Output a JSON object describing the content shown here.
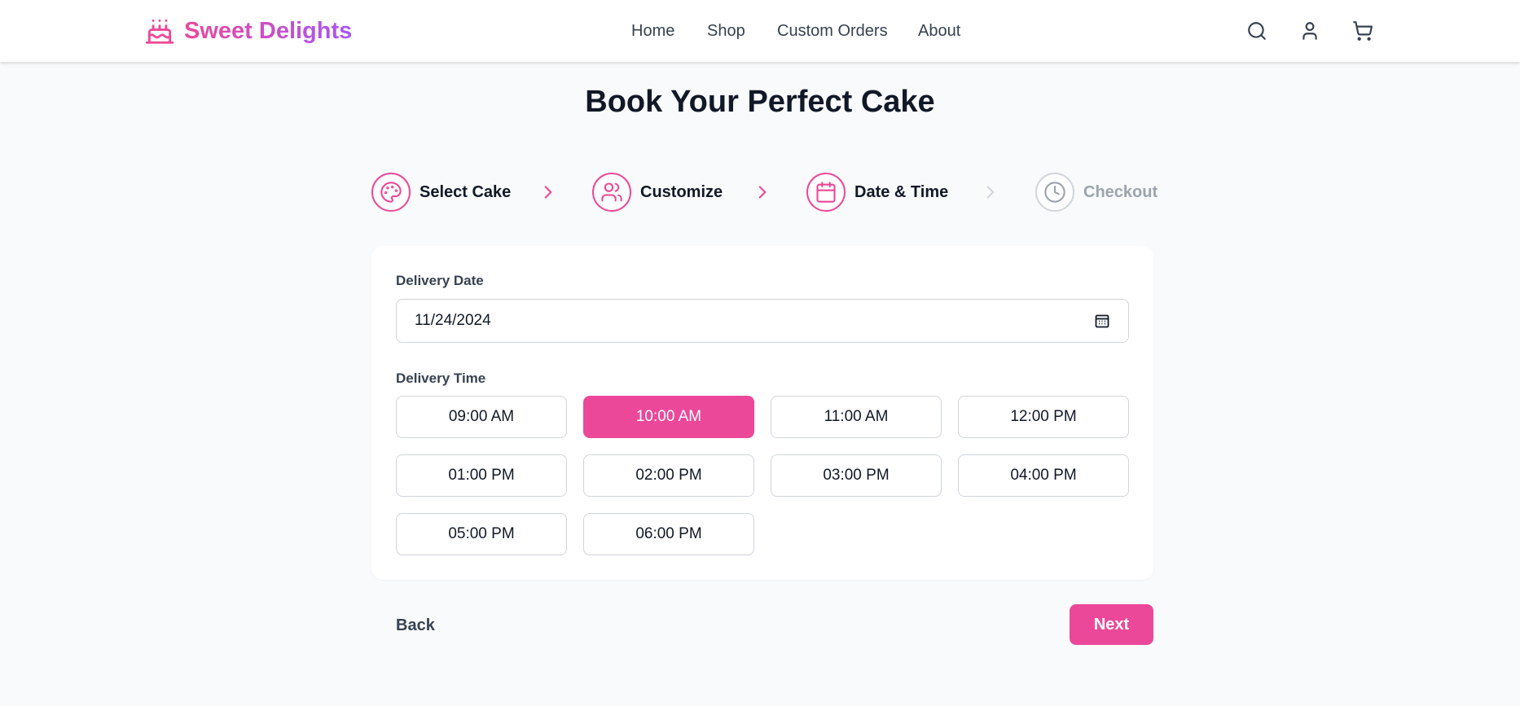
{
  "brand": {
    "name": "Sweet Delights",
    "icon": "cake-icon",
    "gradient_start": "#ec4899",
    "gradient_end": "#a855f7"
  },
  "nav": {
    "items": [
      {
        "label": "Home"
      },
      {
        "label": "Shop"
      },
      {
        "label": "Custom Orders"
      },
      {
        "label": "About"
      }
    ]
  },
  "header_icons": [
    "search-icon",
    "user-icon",
    "cart-icon"
  ],
  "page": {
    "title": "Book Your Perfect Cake"
  },
  "steps": [
    {
      "label": "Select Cake",
      "icon": "palette-icon",
      "active": true
    },
    {
      "label": "Customize",
      "icon": "users-icon",
      "active": true
    },
    {
      "label": "Date & Time",
      "icon": "calendar-icon",
      "active": true
    },
    {
      "label": "Checkout",
      "icon": "clock-icon",
      "active": false
    }
  ],
  "form": {
    "date_label": "Delivery Date",
    "date_value": "11/24/2024",
    "time_label": "Delivery Time",
    "time_slots": [
      {
        "label": "09:00 AM",
        "selected": false
      },
      {
        "label": "10:00 AM",
        "selected": true
      },
      {
        "label": "11:00 AM",
        "selected": false
      },
      {
        "label": "12:00 PM",
        "selected": false
      },
      {
        "label": "01:00 PM",
        "selected": false
      },
      {
        "label": "02:00 PM",
        "selected": false
      },
      {
        "label": "03:00 PM",
        "selected": false
      },
      {
        "label": "04:00 PM",
        "selected": false
      },
      {
        "label": "05:00 PM",
        "selected": false
      },
      {
        "label": "06:00 PM",
        "selected": false
      }
    ]
  },
  "actions": {
    "back_label": "Back",
    "next_label": "Next"
  },
  "colors": {
    "accent": "#ec4899",
    "inactive": "#9ca3af",
    "text": "#111827",
    "background": "#f9fafb"
  }
}
